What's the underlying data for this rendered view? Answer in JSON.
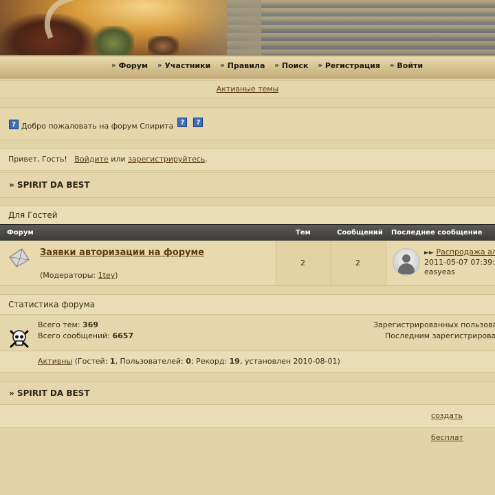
{
  "nav": {
    "items": [
      "Форум",
      "Участники",
      "Правила",
      "Поиск",
      "Регистрация",
      "Войти"
    ]
  },
  "active_topics": "Активные темы",
  "welcome": {
    "icon1": "?",
    "text": "Добро пожаловать на форум Спирита",
    "icon2": "?",
    "icon3": "?"
  },
  "greeting": {
    "hello": "Привет, Гость!",
    "login": "Войдите",
    "or": "или",
    "register": "зарегистрируйтесь",
    "dot": "."
  },
  "breadcrumb": "» SPIRIT DA BEST",
  "guests_section": "Для Гостей",
  "table_headers": {
    "forum": "Форум",
    "topics": "Тем",
    "posts": "Сообщений",
    "last_post": "Последнее сообщение"
  },
  "forum": {
    "title": "Заявки авторизации на форуме",
    "mods_prefix": "(Модераторы: ",
    "mod_name": "1tey",
    "mods_suffix": ")",
    "topics": "2",
    "posts": "2",
    "last_post_title": "Распродажа ал",
    "last_post_date": "2011-05-07 07:39:",
    "last_post_author": "easyeas"
  },
  "stats": {
    "title": "Статистика форума",
    "total_topics_label": "Всего тем: ",
    "total_topics": "369",
    "total_posts_label": "Всего сообщений: ",
    "total_posts": "6657",
    "registered_label": "Зарегистрированных пользова",
    "last_registered_label": "Последним зарегистрирова",
    "online_link": "Активны",
    "online_text1": " (Гостей: ",
    "guests": "1",
    "online_text2": ", Пользователей: ",
    "users": "0",
    "online_text3": "; Рекорд: ",
    "record": "19",
    "online_text4": ", установлен 2010-08-01)"
  },
  "footer": {
    "breadcrumb": "» SPIRIT DA BEST",
    "link": "создать бесплат"
  },
  "colors": {
    "page_bg": "#e3d4a8",
    "link": "#5b3a12",
    "table_header": "#3a3935"
  }
}
